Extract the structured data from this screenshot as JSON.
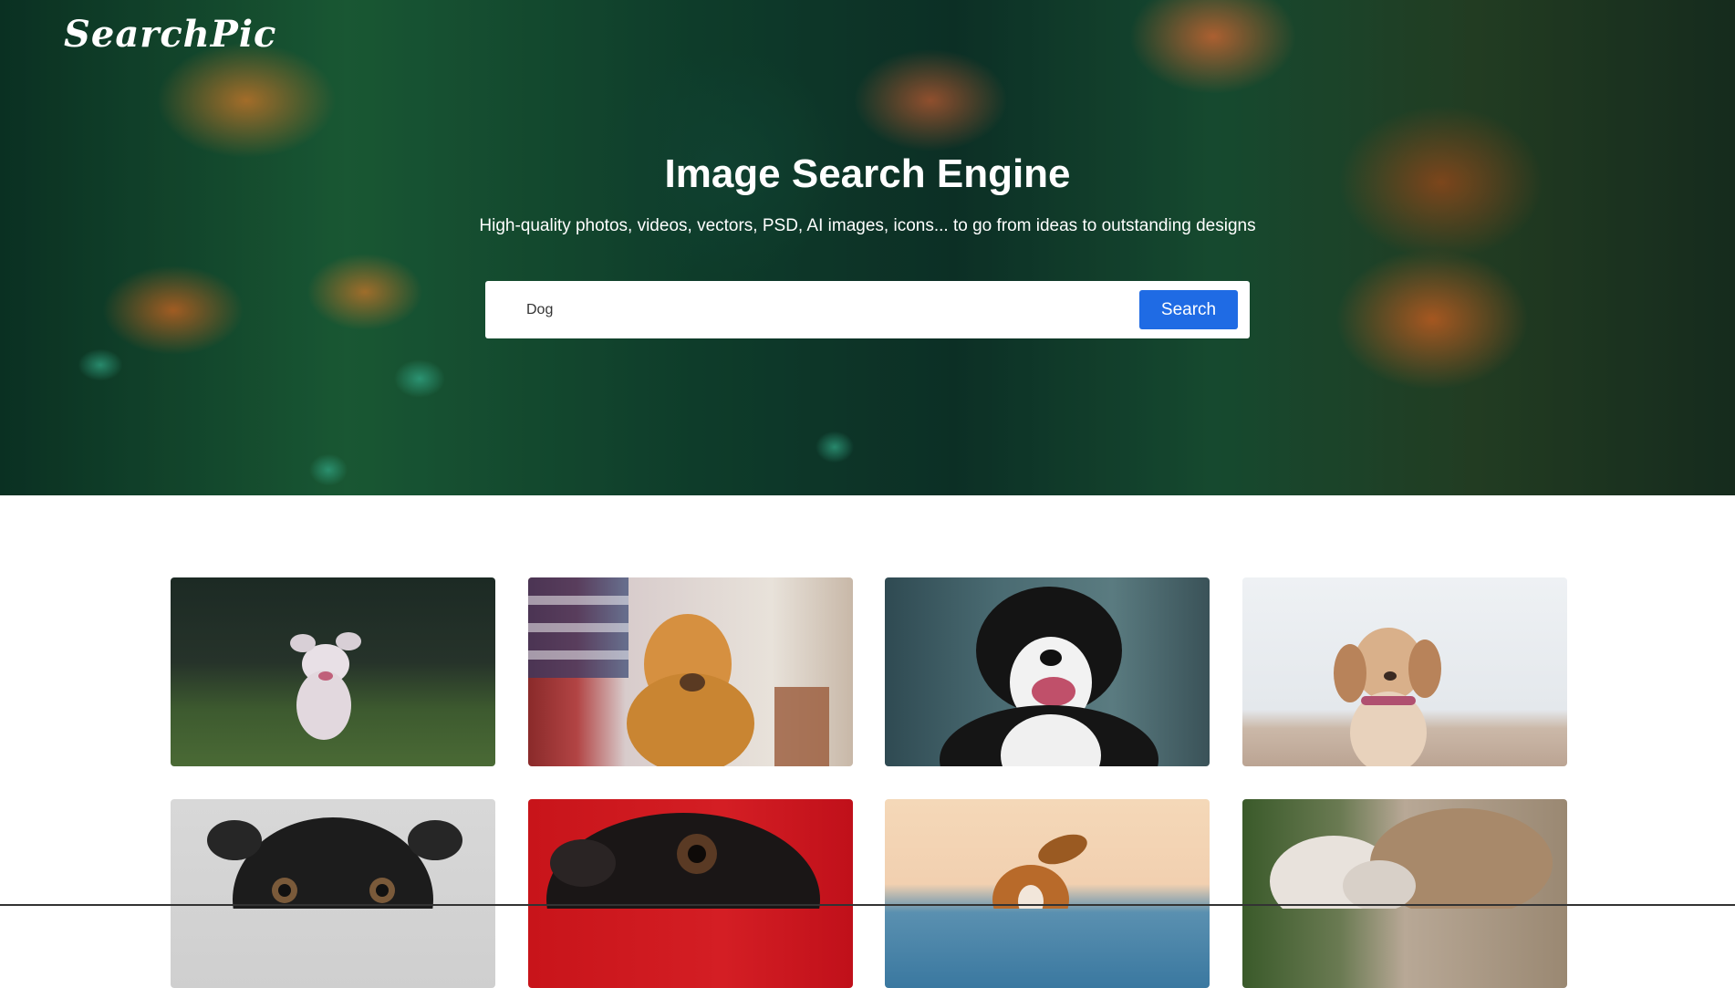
{
  "header": {
    "logo_text": "SearchPic"
  },
  "hero": {
    "title": "Image Search Engine",
    "subtitle": "High-quality photos, videos, vectors, PSD, AI images, icons... to go from ideas to outstanding designs"
  },
  "search": {
    "value": "Dog",
    "button_label": "Search"
  },
  "gallery": {
    "images": [
      {
        "subject": "white fluffy puppy running on grass"
      },
      {
        "subject": "golden retriever in front of american flag"
      },
      {
        "subject": "black and white border collie"
      },
      {
        "subject": "spaniel puppy on beach"
      },
      {
        "subject": "black pug"
      },
      {
        "subject": "black pug on red background"
      },
      {
        "subject": "brown dog at sea"
      },
      {
        "subject": "cat and kitten"
      }
    ]
  },
  "colors": {
    "accent": "#1f6be4",
    "hero_overlay": "#0f3a2e",
    "text_light": "#ffffff"
  }
}
